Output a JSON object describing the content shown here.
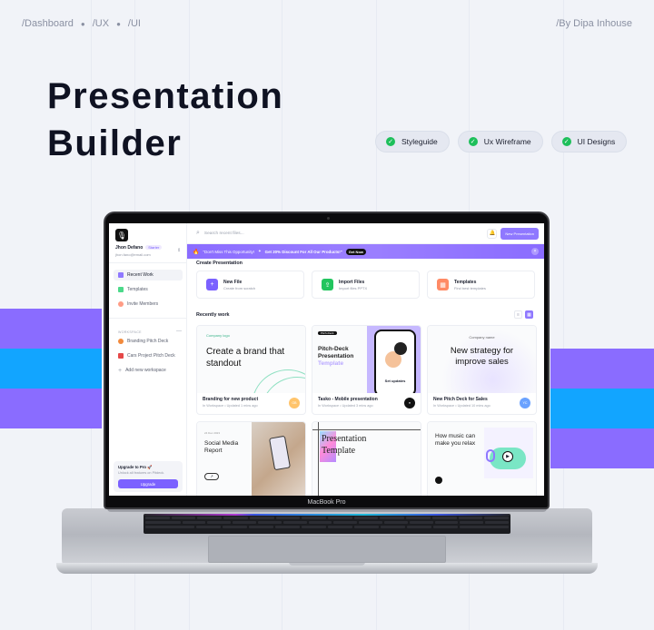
{
  "breadcrumbs": [
    "/Dashboard",
    "/UX",
    "/UI"
  ],
  "author": "/By Dipa Inhouse",
  "hero_title": [
    "Presentation",
    "Builder"
  ],
  "chips": [
    {
      "label": "Styleguide",
      "icon": "check-circle-icon"
    },
    {
      "label": "Ux Wireframe",
      "icon": "check-circle-icon"
    },
    {
      "label": "UI Designs",
      "icon": "check-circle-icon"
    }
  ],
  "colors": {
    "accent": "#7b61ff",
    "band_purple": "#8a6cff",
    "band_blue": "#12a5ff",
    "check_green": "#1dbf5a"
  },
  "device_label": "MacBook Pro",
  "app": {
    "user": {
      "name": "Jhon Defano",
      "plan": "Starter",
      "email": "jhon.fano@email.com"
    },
    "nav": [
      {
        "label": "Recent Work",
        "icon": "grid-icon",
        "active": true
      },
      {
        "label": "Templates",
        "icon": "template-icon",
        "active": false
      },
      {
        "label": "Invite Members",
        "icon": "user-add-icon",
        "active": false
      }
    ],
    "workspace_heading": "WORKSPACE",
    "workspaces": [
      {
        "label": "Branding Pitch Deck",
        "icon": "palette-icon"
      },
      {
        "label": "Cars Project Pitch Deck",
        "icon": "car-icon"
      },
      {
        "label": "Add new workspace",
        "icon": "plus-icon"
      }
    ],
    "upgrade": {
      "title": "Upgrade to Pro 🚀",
      "subtitle": "Unlock all features on Pitdeck.",
      "button": "Upgrade"
    },
    "search_placeholder": "Search recent files...",
    "new_presentation": "New Presentation",
    "promo": {
      "text_quote": "\"Don't Miss This Opportunity!",
      "text_bold": "Get 20% Discount For All Our Products!\"",
      "cta": "Get Now"
    },
    "create_heading": "Create Presentation",
    "create_options": [
      {
        "title": "New File",
        "subtitle": "Create from scratch",
        "icon": "plus-icon",
        "color": "#7b61ff"
      },
      {
        "title": "Import Files",
        "subtitle": "Import files PPTX",
        "icon": "file-import-icon",
        "color": "#22c55e"
      },
      {
        "title": "Templates",
        "subtitle": "Find best templates",
        "icon": "template-icon",
        "color": "#ff8a65"
      }
    ],
    "recent_heading": "Recently work",
    "view_toggle": {
      "list": "list-view-icon",
      "grid": "grid-view-icon",
      "active": "grid"
    },
    "cards": [
      {
        "name": "Branding for new product",
        "workspace": "In Workspace",
        "updated": "Updated 1 mins ago",
        "avatar": "GB",
        "avatar_color": "#ffc46b",
        "thumb": {
          "tag": "Company logo",
          "headline": "Create a brand that standout"
        }
      },
      {
        "name": "Tasko - Mobile presentation",
        "workspace": "In Workspace",
        "updated": "Updated 3 mins ago",
        "avatar": "",
        "avatar_color": "#111111",
        "thumb": {
          "tag": "Pitch-Deck",
          "headline": "Pitch-Deck Presentation",
          "accent": "Template",
          "phone_caption": "Set updates"
        }
      },
      {
        "name": "New Pitch Deck for Sales",
        "workspace": "In Workspace",
        "updated": "Updated 10 mins ago",
        "avatar": "YC",
        "avatar_color": "#6aa2ff",
        "thumb": {
          "tag": "Company name",
          "headline": "New strategy for improve sales"
        }
      },
      {
        "name": "",
        "thumb": {
          "date": "24 Dec 2023",
          "headline": "Social Media Report"
        }
      },
      {
        "name": "",
        "thumb": {
          "headline": "Presentation Template"
        }
      },
      {
        "name": "",
        "thumb": {
          "headline": "How music can make you relax"
        }
      }
    ]
  }
}
